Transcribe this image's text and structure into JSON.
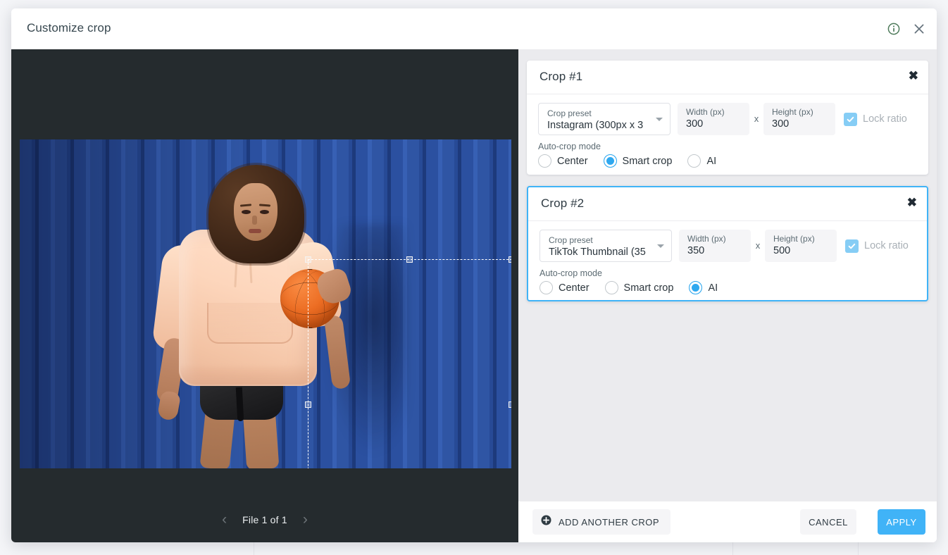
{
  "modal": {
    "title": "Customize crop",
    "info_icon": "info-circle-icon",
    "close_icon": "close-icon"
  },
  "preview": {
    "file_counter": "File 1 of 1",
    "prev_icon": "chevron-left-icon",
    "next_icon": "chevron-right-icon",
    "background_color": "#252b2e",
    "crop_selection": {
      "style": "dashed",
      "handle_count": 8
    }
  },
  "panel": {
    "background_color": "#ebebee",
    "crops": [
      {
        "title": "Crop #1",
        "close_icon": "close-icon",
        "selected": false,
        "preset": {
          "label": "Crop preset",
          "value": "Instagram (300px x 3",
          "caret_icon": "chevron-down-icon"
        },
        "width": {
          "label": "Width (px)",
          "value": "300"
        },
        "separator": "x",
        "height": {
          "label": "Height (px)",
          "value": "300"
        },
        "lock_ratio": {
          "label": "Lock ratio",
          "checked": true,
          "icon": "check-icon"
        },
        "mode": {
          "label": "Auto-crop mode",
          "options": [
            {
              "label": "Center",
              "selected": false
            },
            {
              "label": "Smart crop",
              "selected": true
            },
            {
              "label": "AI",
              "selected": false
            }
          ]
        }
      },
      {
        "title": "Crop #2",
        "close_icon": "close-icon",
        "selected": true,
        "preset": {
          "label": "Crop preset",
          "value": "TikTok Thumbnail (35",
          "caret_icon": "chevron-down-icon"
        },
        "width": {
          "label": "Width (px)",
          "value": "350"
        },
        "separator": "x",
        "height": {
          "label": "Height (px)",
          "value": "500"
        },
        "lock_ratio": {
          "label": "Lock ratio",
          "checked": true,
          "icon": "check-icon"
        },
        "mode": {
          "label": "Auto-crop mode",
          "options": [
            {
              "label": "Center",
              "selected": false
            },
            {
              "label": "Smart crop",
              "selected": false
            },
            {
              "label": "AI",
              "selected": true
            }
          ]
        }
      }
    ]
  },
  "footer": {
    "add_crop_label": "ADD ANOTHER CROP",
    "add_crop_icon": "plus-circle-icon",
    "cancel_label": "CANCEL",
    "apply_label": "APPLY",
    "accent_color": "#40b3f7"
  }
}
